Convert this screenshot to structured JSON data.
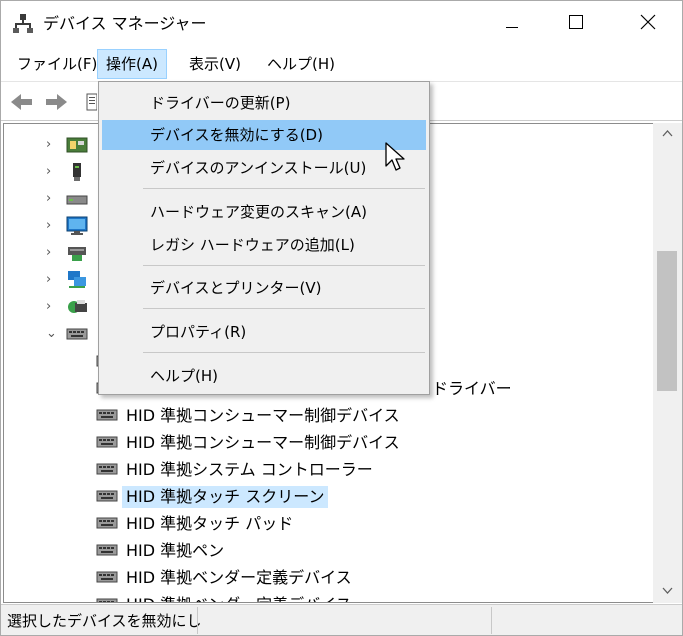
{
  "window": {
    "title": "デバイス マネージャー",
    "controls": {
      "minimize": "minimize-icon",
      "maximize": "maximize-icon",
      "close": "close-icon"
    }
  },
  "menubar": {
    "items": [
      {
        "label": "ファイル(F)"
      },
      {
        "label": "操作(A)",
        "active": true
      },
      {
        "label": "表示(V)"
      },
      {
        "label": "ヘルプ(H)"
      }
    ]
  },
  "toolbar": {
    "icons": [
      "back-arrow-icon",
      "forward-arrow-icon",
      "properties-icon"
    ]
  },
  "dropdown": {
    "items": [
      {
        "label": "ドライバーの更新(P)"
      },
      {
        "label": "デバイスを無効にする(D)",
        "hover": true
      },
      {
        "label": "デバイスのアンインストール(U)"
      },
      {
        "label": "ハードウェア変更のスキャン(A)"
      },
      {
        "label": "レガシ ハードウェアの追加(L)"
      },
      {
        "label": "デバイスとプリンター(V)"
      },
      {
        "label": "プロパティ(R)"
      },
      {
        "label": "ヘルプ(H)"
      }
    ]
  },
  "tree": {
    "category_icons": [
      "card-reader-icon",
      "usb-stick-icon",
      "disk-drive-icon",
      "monitor-icon",
      "network-adapter-icon",
      "network-icon",
      "printer-queue-icon",
      "hid-icon"
    ],
    "partial_row_text": "ドライバー",
    "children": [
      {
        "label": "HID 準拠コンシューマー制御デバイス"
      },
      {
        "label": "HID 準拠コンシューマー制御デバイス"
      },
      {
        "label": "HID 準拠システム コントローラー"
      },
      {
        "label": "HID 準拠タッチ スクリーン",
        "selected": true
      },
      {
        "label": "HID 準拠タッチ パッド"
      },
      {
        "label": "HID 準拠ペン"
      },
      {
        "label": "HID 準拠ベンダー定義デバイス"
      },
      {
        "label": "HID 準拠ベンダー定義デバイス"
      }
    ]
  },
  "statusbar": {
    "text": "選択したデバイスを無効にし"
  },
  "colors": {
    "menu_active": "#cce8ff",
    "dropdown_hover": "#91c9f7",
    "selection": "#cce8ff"
  }
}
